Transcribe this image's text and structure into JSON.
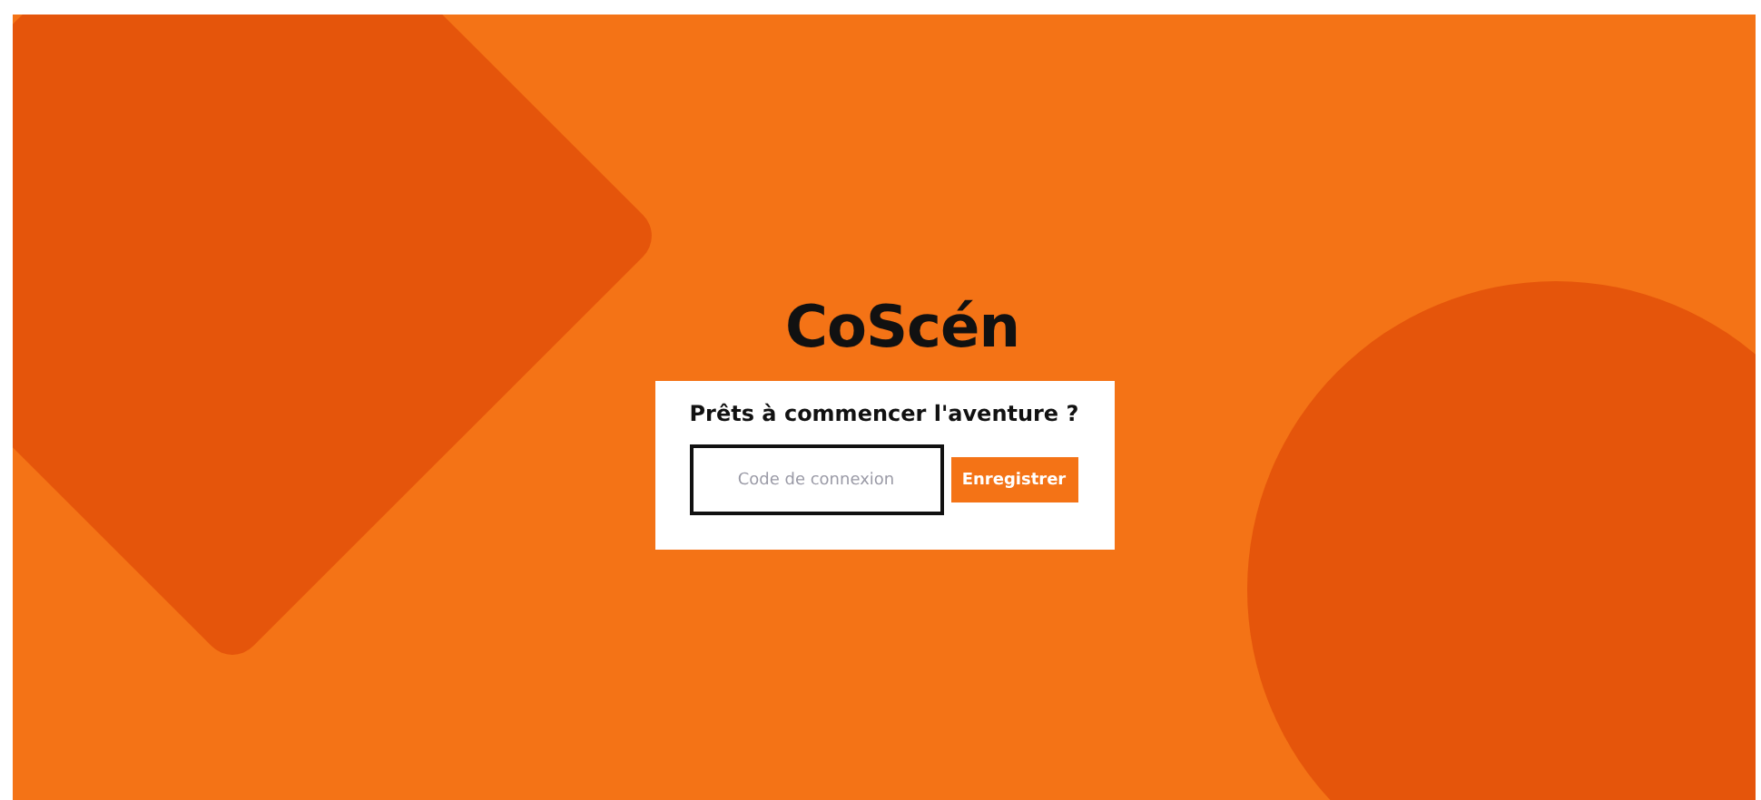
{
  "logo": "CoScén",
  "card": {
    "title": "Prêts à commencer l'aventure ?",
    "code_field": {
      "placeholder": "Code de connexion"
    },
    "submit_button": "Enregistrer"
  }
}
